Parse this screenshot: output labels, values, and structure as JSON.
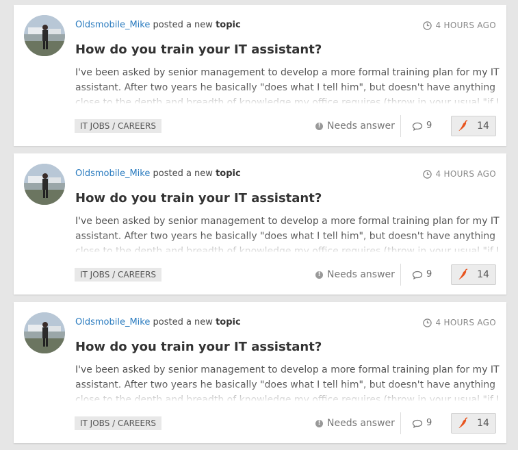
{
  "posts": [
    {
      "author": "Oldsmobile_Mike",
      "action_text": "posted a new",
      "action_type": "topic",
      "time": "4 HOURS AGO",
      "title": "How do you train your IT assistant?",
      "excerpt": "I've been asked by senior management to develop a more formal training plan for my IT assistant.  After two years he basically \"does what I tell him\", but doesn't have anything close to the depth and breadth of knowledge my office requires (throw in your usual \"if I get hit by a",
      "tag": "IT JOBS / CAREERS",
      "status": "Needs answer",
      "comment_count": "9",
      "vote_count": "14"
    },
    {
      "author": "Oldsmobile_Mike",
      "action_text": "posted a new",
      "action_type": "topic",
      "time": "4 HOURS AGO",
      "title": "How do you train your IT assistant?",
      "excerpt": "I've been asked by senior management to develop a more formal training plan for my IT assistant.  After two years he basically \"does what I tell him\", but doesn't have anything close to the depth and breadth of knowledge my office requires (throw in your usual \"if I get hit by a",
      "tag": "IT JOBS / CAREERS",
      "status": "Needs answer",
      "comment_count": "9",
      "vote_count": "14"
    },
    {
      "author": "Oldsmobile_Mike",
      "action_text": "posted a new",
      "action_type": "topic",
      "time": "4 HOURS AGO",
      "title": "How do you train your IT assistant?",
      "excerpt": "I've been asked by senior management to develop a more formal training plan for my IT assistant.  After two years he basically \"does what I tell him\", but doesn't have anything close to the depth and breadth of knowledge my office requires (throw in your usual \"if I get hit by a",
      "tag": "IT JOBS / CAREERS",
      "status": "Needs answer",
      "comment_count": "9",
      "vote_count": "14"
    }
  ],
  "icons": {
    "clock": "clock-icon",
    "status": "info-icon",
    "comments": "speech-bubble-icon",
    "votes": "chili-pepper-icon"
  },
  "colors": {
    "author_link": "#2a7bbf",
    "pepper": "#e8541e",
    "background": "#e6e6e6"
  }
}
